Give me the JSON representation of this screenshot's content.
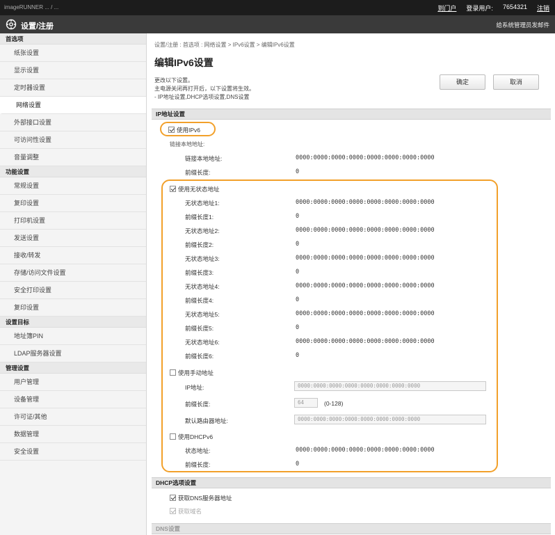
{
  "topbar": {
    "crumb": "imageRUNNER   ...  /  ...",
    "portal": "到门户",
    "login_label": "登录用户:",
    "login_user": "7654321",
    "logout": "注销"
  },
  "titlebar": {
    "title": "设置/注册",
    "mail": "给系统管理员发邮件"
  },
  "sidebar": {
    "sections": [
      {
        "head": "首选项",
        "items": [
          "纸张设置",
          "显示设置",
          "定时器设置",
          "网络设置",
          "外部接口设置",
          "可访问性设置",
          "音量调整"
        ]
      },
      {
        "head": "功能设置",
        "items": [
          "常规设置",
          "复印设置",
          "打印机设置",
          "发送设置",
          "接收/转发",
          "存储/访问文件设置",
          "安全打印设置",
          "复印设置"
        ]
      },
      {
        "head": "设置目标",
        "items": [
          "地址簿PIN",
          "LDAP服务器设置"
        ]
      },
      {
        "head": "管理设置",
        "items": [
          "用户管理",
          "设备管理",
          "许可证/其他",
          "数据管理",
          "安全设置"
        ]
      }
    ],
    "active": "网络设置"
  },
  "main": {
    "breadcrumb": "设置/注册 : 首选项 : 网络设置 > IPv6设置 > 编辑IPv6设置",
    "title": "编辑IPv6设置",
    "notes": [
      "更改以下设置。",
      "主电源关闭再打开后，以下设置将生效。",
      "- IP地址设置,DHCP选项设置,DNS设置"
    ],
    "ok": "确定",
    "cancel": "取消",
    "ip_section": "IP地址设置",
    "use_ipv6": "使用IPv6",
    "link_local_head": "链接本地地址:",
    "link_local_addr_label": "链接本地地址:",
    "prefix_label": "前缀长度:",
    "zero_addr": "0000:0000:0000:0000:0000:0000:0000:0000",
    "zero": "0",
    "stateless_label": "使用无状态地址",
    "stateless": [
      {
        "addr_label": "无状态地址1:",
        "prefix_label": "前缀长度1:"
      },
      {
        "addr_label": "无状态地址2:",
        "prefix_label": "前缀长度2:"
      },
      {
        "addr_label": "无状态地址3:",
        "prefix_label": "前缀长度3:"
      },
      {
        "addr_label": "无状态地址4:",
        "prefix_label": "前缀长度4:"
      },
      {
        "addr_label": "无状态地址5:",
        "prefix_label": "前缀长度5:"
      },
      {
        "addr_label": "无状态地址6:",
        "prefix_label": "前缀长度6:"
      }
    ],
    "manual_label": "使用手动地址",
    "ip_addr_label": "IP地址:",
    "ip_addr_value": "0000:0000:0000:0000:0000:0000:0000:0000",
    "manual_prefix_label": "前缀长度:",
    "manual_prefix_value": "64",
    "manual_prefix_range": "(0-128)",
    "gateway_label": "默认路由器地址:",
    "gateway_value": "0000:0000:0000:0000:0000:0000:0000:0000",
    "dhcp_label": "使用DHCPv6",
    "stateful_label": "状态地址:",
    "stateful_prefix_label": "前缀长度:",
    "dhcp_section": "DHCP选项设置",
    "dns_acquire": "获取DNS服务器地址",
    "domain_acquire": "获取域名",
    "dns_section": "DNS设置"
  },
  "colors": {
    "highlight": "#f2a02a",
    "topbar": "#1c1c1c",
    "titlebar": "#3a3a3a"
  }
}
